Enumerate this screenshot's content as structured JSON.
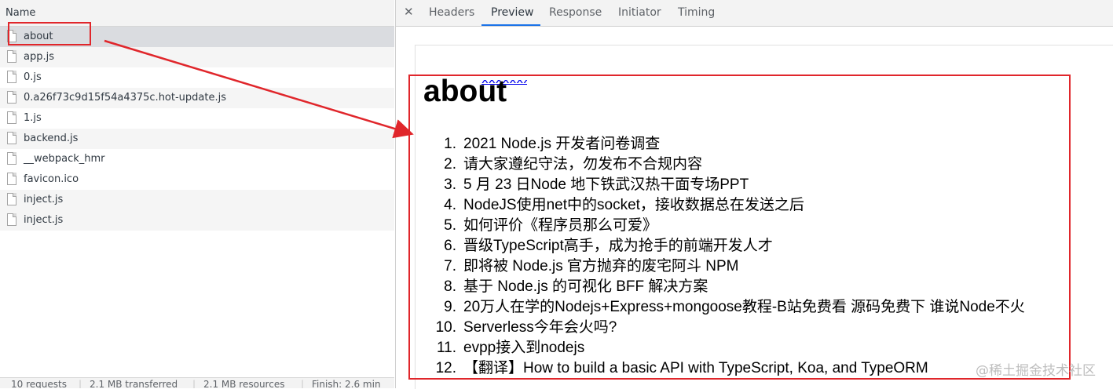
{
  "network_list": {
    "column_header": "Name",
    "files": [
      {
        "name": "about"
      },
      {
        "name": "app.js"
      },
      {
        "name": "0.js"
      },
      {
        "name": "0.a26f73c9d15f54a4375c.hot-update.js"
      },
      {
        "name": "1.js"
      },
      {
        "name": "backend.js"
      },
      {
        "name": "__webpack_hmr"
      },
      {
        "name": "favicon.ico"
      },
      {
        "name": "inject.js"
      },
      {
        "name": "inject.js"
      }
    ],
    "status": {
      "requests": "10 requests",
      "transferred": "2.1 MB transferred",
      "resources": "2.1 MB resources",
      "finish": "Finish: 2.6 min"
    }
  },
  "detail_panel": {
    "close_icon": "close-icon",
    "tabs": [
      {
        "label": "Headers"
      },
      {
        "label": "Preview"
      },
      {
        "label": "Response"
      },
      {
        "label": "Initiator"
      },
      {
        "label": "Timing"
      }
    ],
    "active_tab": "Preview"
  },
  "preview": {
    "heading": "about",
    "articles": [
      {
        "num": "1.",
        "title": "2021 Node.js 开发者问卷调查"
      },
      {
        "num": "2.",
        "title": "请大家遵纪守法，勿发布不合规内容"
      },
      {
        "num": "3.",
        "title": "5 月 23 日Node 地下铁武汉热干面专场PPT"
      },
      {
        "num": "4.",
        "title": "NodeJS使用net中的socket，接收数据总在发送之后"
      },
      {
        "num": "5.",
        "title": "如何评价《程序员那么可爱》"
      },
      {
        "num": "6.",
        "title": "晋级TypeScript高手，成为抢手的前端开发人才"
      },
      {
        "num": "7.",
        "title": "即将被 Node.js 官方抛弃的废宅阿斗 NPM"
      },
      {
        "num": "8.",
        "title": "基于 Node.js 的可视化 BFF 解决方案"
      },
      {
        "num": "9.",
        "title": "20万人在学的Nodejs+Express+mongoose教程-B站免费看 源码免费下 谁说Node不火"
      },
      {
        "num": "10.",
        "title": "Serverless今年会火吗?"
      },
      {
        "num": "11.",
        "title": "evpp接入到nodejs"
      },
      {
        "num": "12.",
        "title": "【翻译】How to build a basic API with TypeScript, Koa, and TypeORM"
      }
    ]
  },
  "watermark": "@稀土掘金技术社区",
  "colors": {
    "annotation_red": "#e0262b",
    "selected_row": "#dadce0",
    "active_tab_underline": "#1a73e8"
  }
}
